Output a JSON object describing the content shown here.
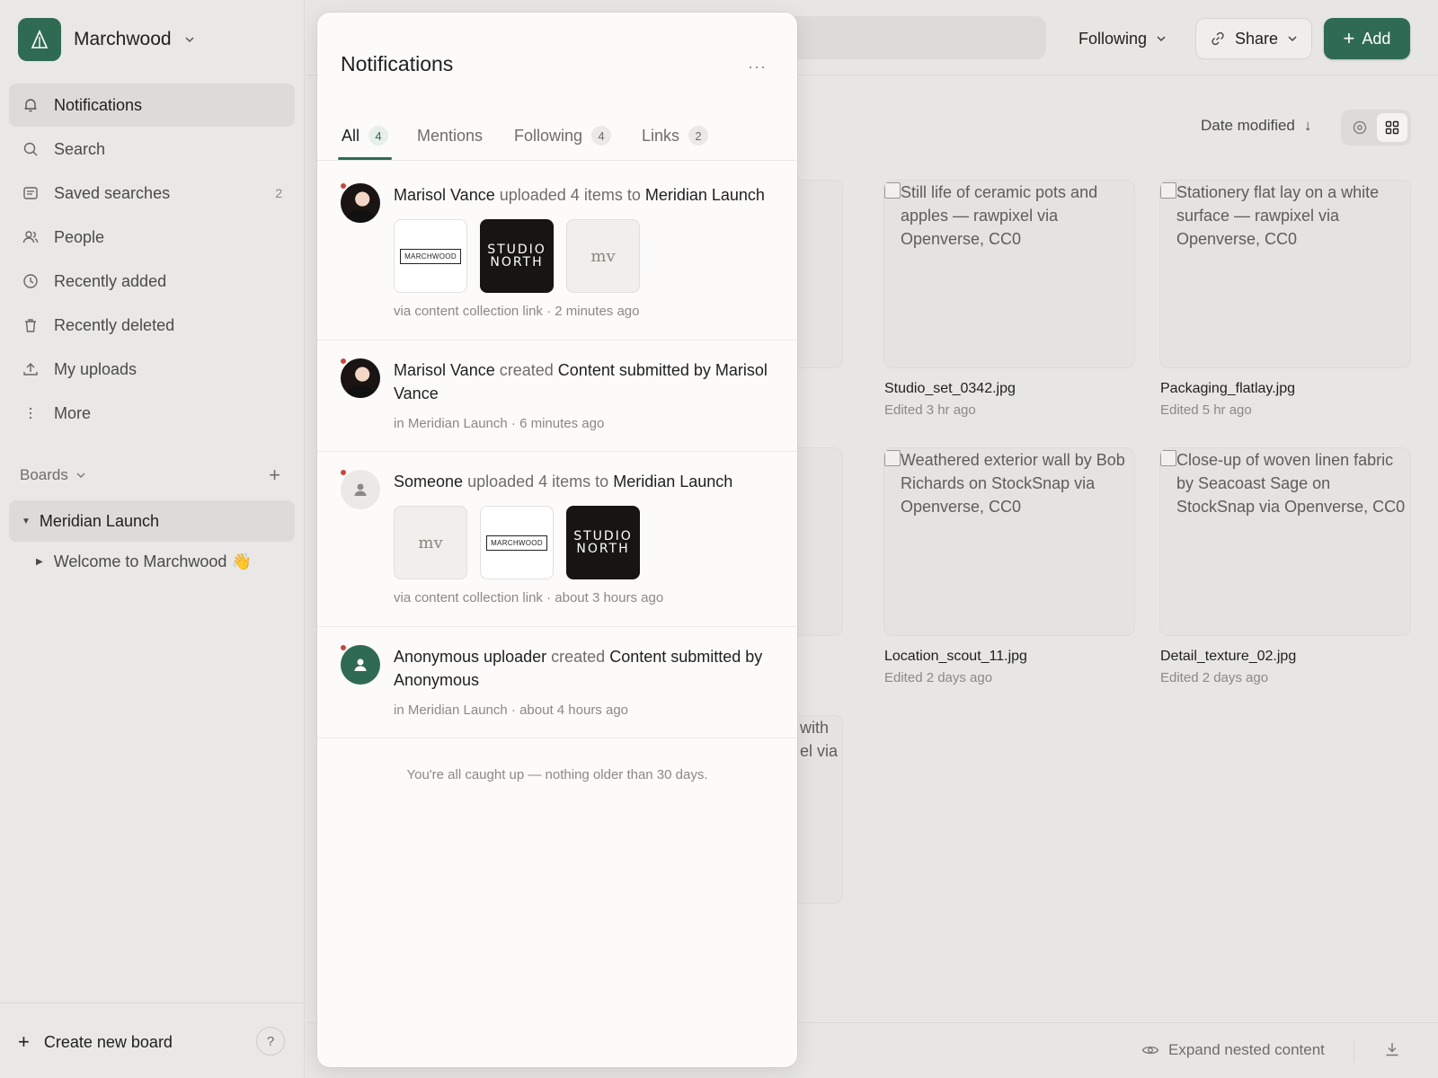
{
  "colors": {
    "accent": "#2f6b52",
    "unread_dot": "#c9473d"
  },
  "workspace": {
    "name": "Marchwood",
    "logo_icon": "triangle-logo-icon"
  },
  "sidebar": {
    "items": [
      {
        "label": "Notifications",
        "icon": "bell-icon"
      },
      {
        "label": "Search",
        "icon": "search-icon"
      },
      {
        "label": "Saved searches",
        "icon": "saved-search-icon",
        "count": "2"
      },
      {
        "label": "People",
        "icon": "people-icon"
      },
      {
        "label": "Recently added",
        "icon": "clock-icon"
      },
      {
        "label": "Recently deleted",
        "icon": "trash-icon"
      },
      {
        "label": "My uploads",
        "icon": "upload-icon"
      },
      {
        "label": "More",
        "icon": "more-vertical-icon"
      }
    ],
    "boards_label": "Boards",
    "board": "Meridian Launch",
    "sub_board": "Welcome to Marchwood 👋",
    "create_board": "Create new board",
    "help": "?"
  },
  "toolbar": {
    "following": "Following",
    "share": "Share",
    "add": "Add"
  },
  "sort": {
    "label": "Date modified"
  },
  "cards": [
    {
      "alt": "Still life of ceramic pots and apples — rawpixel via Openverse, CC0",
      "name": "Studio_set_0342.jpg",
      "edited": "Edited 3 hr ago"
    },
    {
      "alt": "Stationery flat lay on a white surface — rawpixel via Openverse, CC0",
      "name": "Packaging_flatlay.jpg",
      "edited": "Edited 5 hr ago"
    },
    {
      "alt": "Weathered exterior wall by Bob Richards on StockSnap via Openverse, CC0",
      "name": "Location_scout_11.jpg",
      "edited": "Edited 2 days ago"
    },
    {
      "alt": "Close-up of woven linen fabric by Seacoast Sage on StockSnap via Openverse, CC0",
      "name": "Detail_texture_02.jpg",
      "edited": "Edited 2 days ago"
    }
  ],
  "ghost_text": {
    "line1": "with",
    "line2": "el via"
  },
  "bottom": {
    "expand": "Expand nested content"
  },
  "notifications": {
    "title": "Notifications",
    "more": "···",
    "tabs": [
      {
        "label": "All",
        "count": "4"
      },
      {
        "label": "Mentions"
      },
      {
        "label": "Following",
        "count": "4"
      },
      {
        "label": "Links",
        "count": "2"
      }
    ],
    "items": [
      {
        "actor": "Marisol Vance",
        "verb": "uploaded 4 items to",
        "target": "Meridian Launch",
        "meta": "via content collection link · 2 minutes ago"
      },
      {
        "actor": "Marisol Vance",
        "verb": "created",
        "target": "Content submitted by Marisol Vance",
        "meta": "in Meridian Launch · 6 minutes ago"
      },
      {
        "actor": "Someone",
        "verb": "uploaded 4 items to",
        "target": "Meridian Launch",
        "meta": "via content collection link · about 3 hours ago"
      },
      {
        "actor": "Anonymous uploader",
        "verb": "created",
        "target": "Content submitted by Anonymous",
        "meta": "in Meridian Launch · about 4 hours ago"
      }
    ],
    "thumb_marchwood": "MARCHWOOD",
    "thumb_studio_1": "STUDIO",
    "thumb_studio_2": "NORTH",
    "thumb_mv": "mv",
    "caught_up": "You're all caught up — nothing older than 30 days."
  }
}
